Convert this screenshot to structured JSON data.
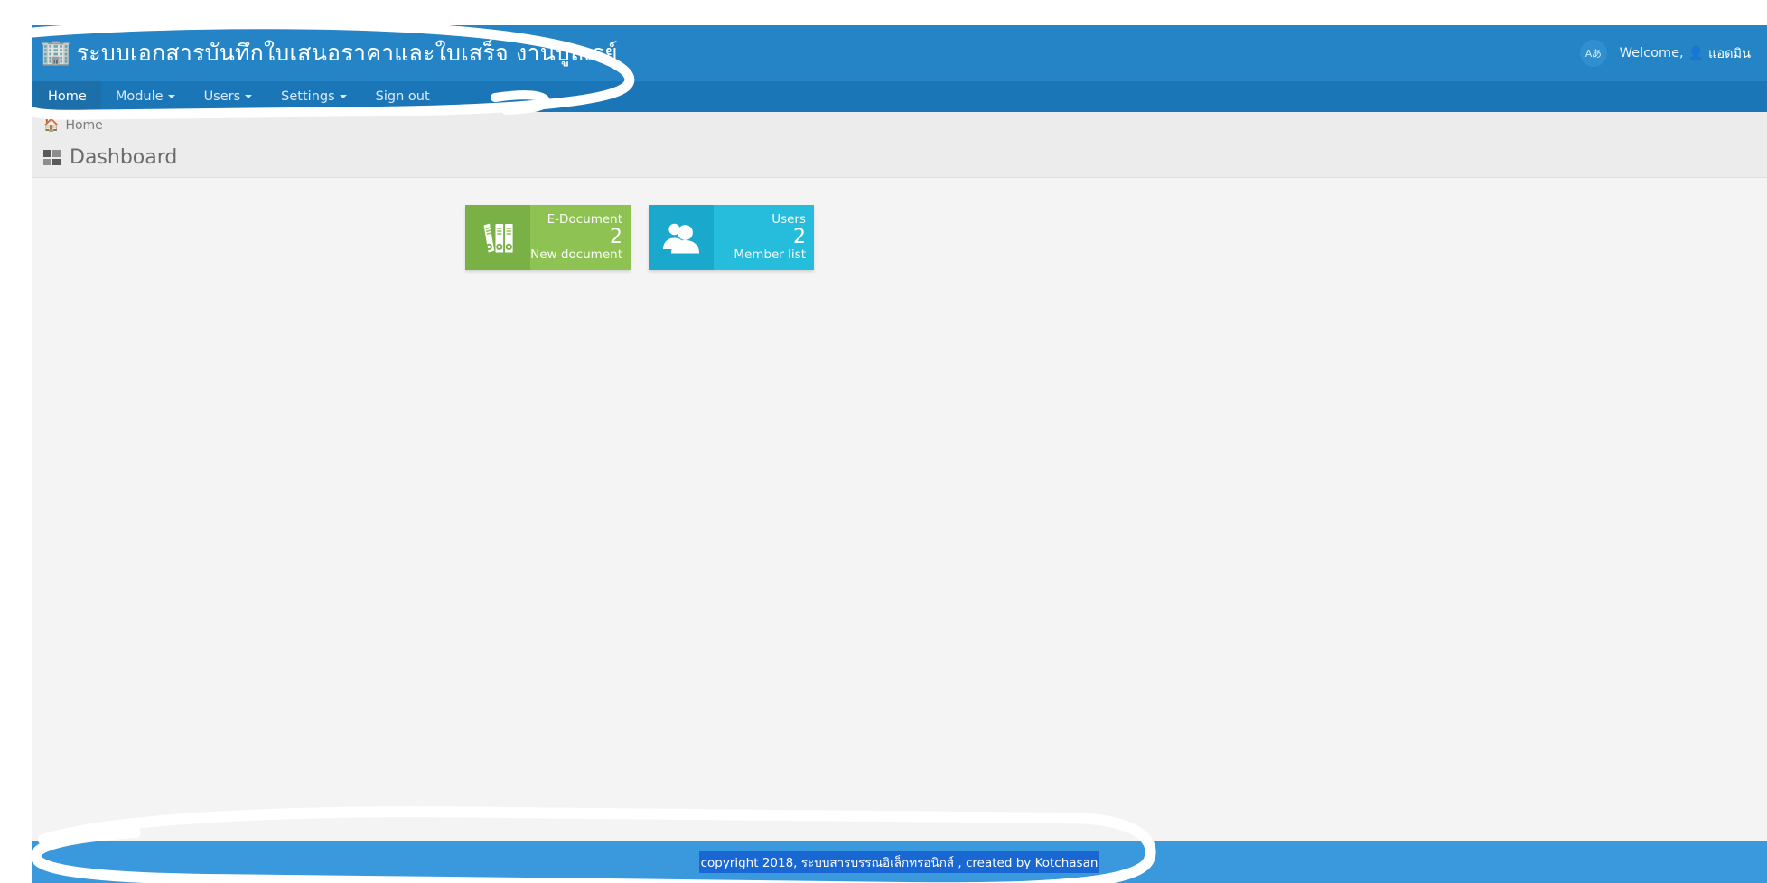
{
  "header": {
    "brand_icon": "building-icon",
    "brand_title": "ระบบเอกสารบันทึกใบเสนอราคาและใบเสร็จ งานบูลเรย์",
    "lang_badge": "Aあ",
    "welcome_label": "Welcome,",
    "user_icon": "user-icon",
    "user_name": "แอดมิน"
  },
  "nav": {
    "items": [
      {
        "label": "Home",
        "active": true,
        "has_caret": false
      },
      {
        "label": "Module",
        "active": false,
        "has_caret": true
      },
      {
        "label": "Users",
        "active": false,
        "has_caret": true
      },
      {
        "label": "Settings",
        "active": false,
        "has_caret": true
      },
      {
        "label": "Sign out",
        "active": false,
        "has_caret": false
      }
    ]
  },
  "breadcrumb": {
    "home_icon": "home-icon",
    "items": [
      "Home"
    ]
  },
  "page": {
    "title_icon": "dashboard-grid-icon",
    "title": "Dashboard"
  },
  "tiles": [
    {
      "icon": "binders-archive-icon",
      "top_label": "E-Document",
      "count": "2",
      "bottom_label": "New document",
      "icon_bg": "#79b147",
      "body_bg": "#8ec354"
    },
    {
      "icon": "users-group-icon",
      "top_label": "Users",
      "count": "2",
      "bottom_label": "Member list",
      "icon_bg": "#1aa8cd",
      "body_bg": "#26bcdb"
    }
  ],
  "footer": {
    "text": "copyright 2018, ระบบสารบรรณอิเล็กทรอนิกส์ , created by Kotchasan",
    "selected": true,
    "selection_color": "#1867d2"
  },
  "annotations": {
    "color": "#ffffff",
    "marks": [
      {
        "name": "title-lasso-annotation"
      },
      {
        "name": "footer-lasso-annotation"
      }
    ]
  },
  "colors": {
    "header_blue": "#2484c6",
    "nav_blue": "#1b76b7",
    "nav_active_blue": "#1c6fa8",
    "footer_blue": "#3a99dc",
    "page_bg": "#f4f4f4",
    "bar_bg": "#ececec"
  }
}
